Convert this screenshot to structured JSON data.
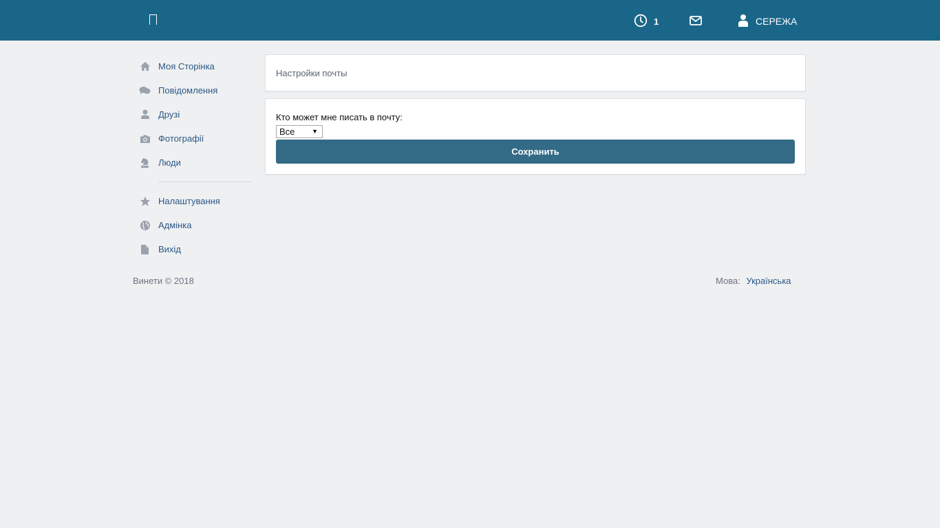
{
  "header": {
    "notifications_count": "1",
    "user_name": "СЕРЕЖА",
    "icons": {
      "logo": "box-glyph-icon",
      "notifications": "clock-icon",
      "mail": "envelope-icon",
      "user": "user-icon"
    }
  },
  "sidebar": {
    "items": [
      {
        "label": "Моя Сторінка",
        "icon": "home-icon"
      },
      {
        "label": "Повідомлення",
        "icon": "chat-icon"
      },
      {
        "label": "Друзі",
        "icon": "user-icon"
      },
      {
        "label": "Фотографії",
        "icon": "camera-icon"
      },
      {
        "label": "Люди",
        "icon": "chess-knight-icon"
      }
    ],
    "secondary_items": [
      {
        "label": "Налаштування",
        "icon": "star-icon"
      },
      {
        "label": "Адмінка",
        "icon": "globe-icon"
      },
      {
        "label": "Вихід",
        "icon": "file-icon"
      }
    ]
  },
  "main": {
    "title": "Настройки почты",
    "form": {
      "label": "Кто может мне писать в почту:",
      "select_value": "Все",
      "save_label": "Сохранить"
    }
  },
  "footer": {
    "copyright": "Винети © 2018",
    "lang_label": "Мова:",
    "lang_value": "Українська"
  },
  "colors": {
    "header_bg": "#1a6689",
    "page_bg": "#eff0f2",
    "link": "#2a5885",
    "button_bg": "#336a85",
    "icon": "#99a2ad"
  }
}
